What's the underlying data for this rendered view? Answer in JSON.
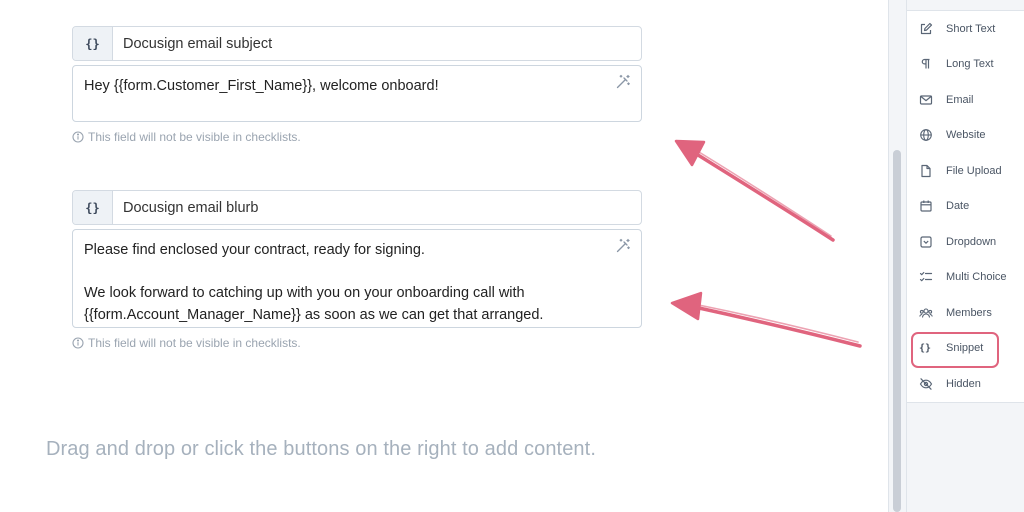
{
  "snippets": [
    {
      "icon": "curly-braces-icon",
      "icon_glyph": "{}",
      "title": "Docusign email subject",
      "body_lines": [
        "Hey {{form.Customer_First_Name}}, welcome onboard!"
      ],
      "note": "This field will not be visible in checklists."
    },
    {
      "icon": "curly-braces-icon",
      "icon_glyph": "{}",
      "title": "Docusign email blurb",
      "body_lines": [
        "Please find enclosed your contract, ready for signing.",
        "",
        "We look forward to catching up with you on your onboarding call with",
        "{{form.Account_Manager_Name}} as soon as we can get that arranged."
      ],
      "note": "This field will not be visible in checklists."
    }
  ],
  "empty_hint": "Drag and drop or click the buttons on the right to add content.",
  "panel": {
    "items": [
      {
        "label": "Short Text",
        "icon": "edit-pencil-icon"
      },
      {
        "label": "Long Text",
        "icon": "paragraph-icon"
      },
      {
        "label": "Email",
        "icon": "envelope-icon"
      },
      {
        "label": "Website",
        "icon": "globe-icon"
      },
      {
        "label": "File Upload",
        "icon": "file-icon"
      },
      {
        "label": "Date",
        "icon": "calendar-icon"
      },
      {
        "label": "Dropdown",
        "icon": "dropdown-icon"
      },
      {
        "label": "Multi Choice",
        "icon": "checklist-icon"
      },
      {
        "label": "Members",
        "icon": "members-icon"
      },
      {
        "label": "Snippet",
        "icon": "curly-braces-icon",
        "glyph": "{}",
        "highlighted": true
      },
      {
        "label": "Hidden",
        "icon": "eye-slash-icon"
      }
    ]
  },
  "colors": {
    "annotation_arrow": "#e0647e",
    "hint_text": "#a6b1bd",
    "note_text": "#9aa4b0"
  }
}
